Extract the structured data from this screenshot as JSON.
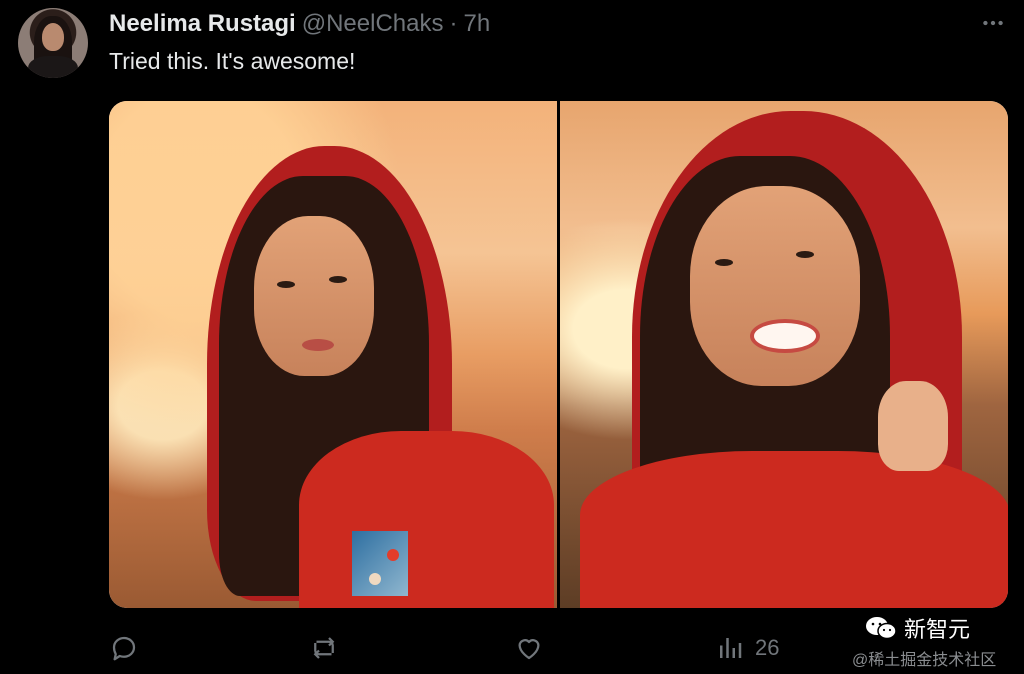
{
  "post": {
    "author_name": "Neelima Rustagi",
    "handle": "@NeelChaks",
    "separator": "·",
    "time": "7h",
    "text": "Tried this. It's awesome!",
    "media": [
      {
        "label": "generated-portrait-1"
      },
      {
        "label": "generated-portrait-2"
      }
    ]
  },
  "actions": {
    "reply_icon": "reply-icon",
    "repost_icon": "repost-icon",
    "like_icon": "heart-icon",
    "views_icon": "views-icon",
    "views_count": "26"
  },
  "watermark": {
    "brand": "新智元",
    "source": "@稀土掘金技术社区"
  },
  "colors": {
    "background": "#000000",
    "text_primary": "#e7e9ea",
    "text_secondary": "#71767b"
  }
}
